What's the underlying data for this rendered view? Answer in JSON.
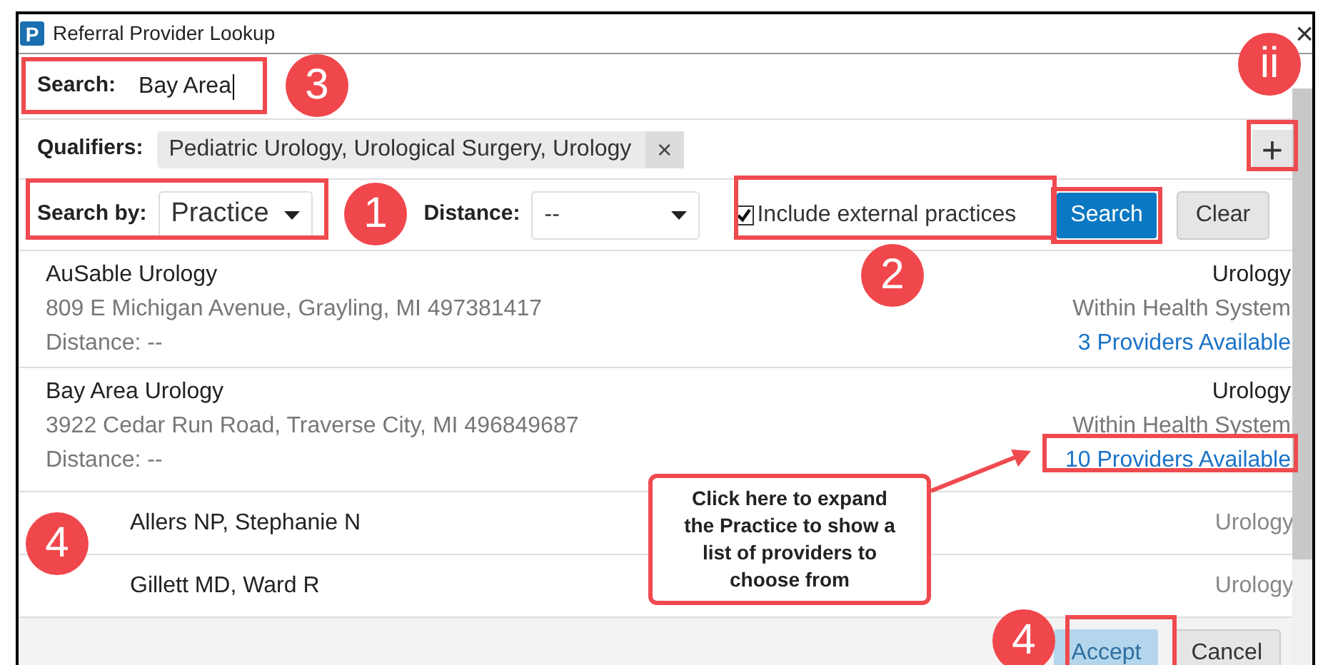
{
  "window": {
    "title": "Referral Provider Lookup",
    "logo": "P"
  },
  "search": {
    "label": "Search:",
    "value": "Bay Area"
  },
  "qualifiers": {
    "label": "Qualifiers:",
    "value": "Pediatric Urology, Urological Surgery, Urology",
    "remove": "×",
    "add": "+"
  },
  "search_by": {
    "label": "Search by:",
    "value": "Practice"
  },
  "distance": {
    "label": "Distance:",
    "value": "--"
  },
  "include_external": {
    "label": "Include external practices",
    "checked": true
  },
  "buttons": {
    "search": "Search",
    "clear": "Clear"
  },
  "practices": [
    {
      "name": "AuSable Urology",
      "address": "809 E Michigan Avenue, Grayling, MI 497381417",
      "distance": "Distance: --",
      "specialty": "Urology",
      "network": "Within Health System",
      "providers_link": "3 Providers Available"
    },
    {
      "name": "Bay Area Urology",
      "address": "3922 Cedar Run Road, Traverse City, MI 496849687",
      "distance": "Distance: --",
      "specialty": "Urology",
      "network": "Within Health System",
      "providers_link": "10 Providers Available"
    }
  ],
  "providers": [
    {
      "name": "Allers NP, Stephanie N",
      "specialty": "Urology"
    },
    {
      "name": "Gillett MD, Ward R",
      "specialty": "Urology"
    }
  ],
  "footer": {
    "accept": {
      "label": "Accept",
      "disabled": true
    },
    "cancel": {
      "label": "Cancel",
      "disabled": false
    }
  },
  "close": "×",
  "annotations": {
    "markers": [
      "3",
      "ii",
      "1",
      "2",
      "4",
      "4"
    ],
    "callout": "Click here to expand the Practice to show a list of providers to choose from"
  }
}
